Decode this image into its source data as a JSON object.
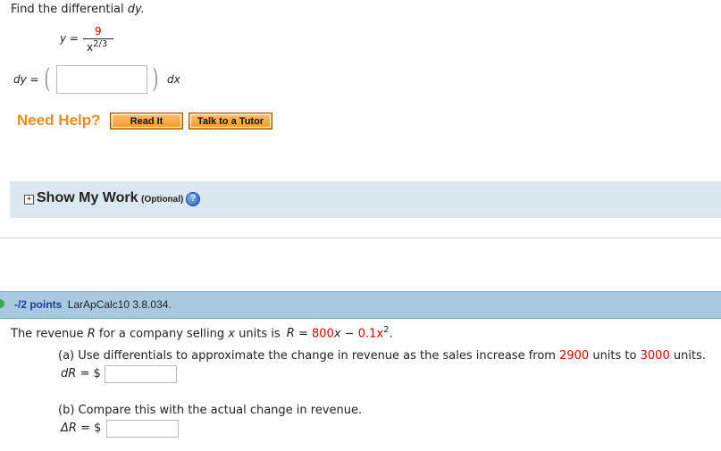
{
  "q1": {
    "prompt": "Find the differential",
    "prompt_var": "dy.",
    "eq_lhs": "y =",
    "numerator": "9",
    "denom_base": "x",
    "denom_exp": "2/3",
    "dy_label": "dy",
    "eq_sign": "=",
    "dx_label": "dx",
    "answer_value": ""
  },
  "help": {
    "title": "Need Help?",
    "read_label": "Read It",
    "tutor_label": "Talk to a Tutor"
  },
  "show_work": {
    "plus_glyph": "+",
    "title": "Show My Work",
    "optional": "(Optional)",
    "help_glyph": "?"
  },
  "q2": {
    "points": "-/2 points",
    "code": "LarApCalc10 3.8.034.",
    "stmt_a": "The revenue",
    "stmt_R": "R",
    "stmt_b": "for a company selling",
    "stmt_x": "x",
    "stmt_c": "units is",
    "stmt_R2": "R",
    "stmt_eq": "=",
    "stmt_f1": "800",
    "stmt_f1x": "x",
    "stmt_minus": "−",
    "stmt_f2": "0.1x",
    "stmt_f2exp": "2",
    "stmt_end": ".",
    "part_a_text1": "(a) Use differentials to approximate the change in revenue as the sales increase from",
    "part_a_num1": "2900",
    "part_a_text2": "units to",
    "part_a_num2": "3000",
    "part_a_text3": "units.",
    "part_a_label": "dR",
    "part_a_eq": "= $",
    "part_a_value": "",
    "part_b_text": "(b) Compare this with the actual change in revenue.",
    "part_b_label": "ΔR",
    "part_b_eq": "= $",
    "part_b_value": ""
  }
}
